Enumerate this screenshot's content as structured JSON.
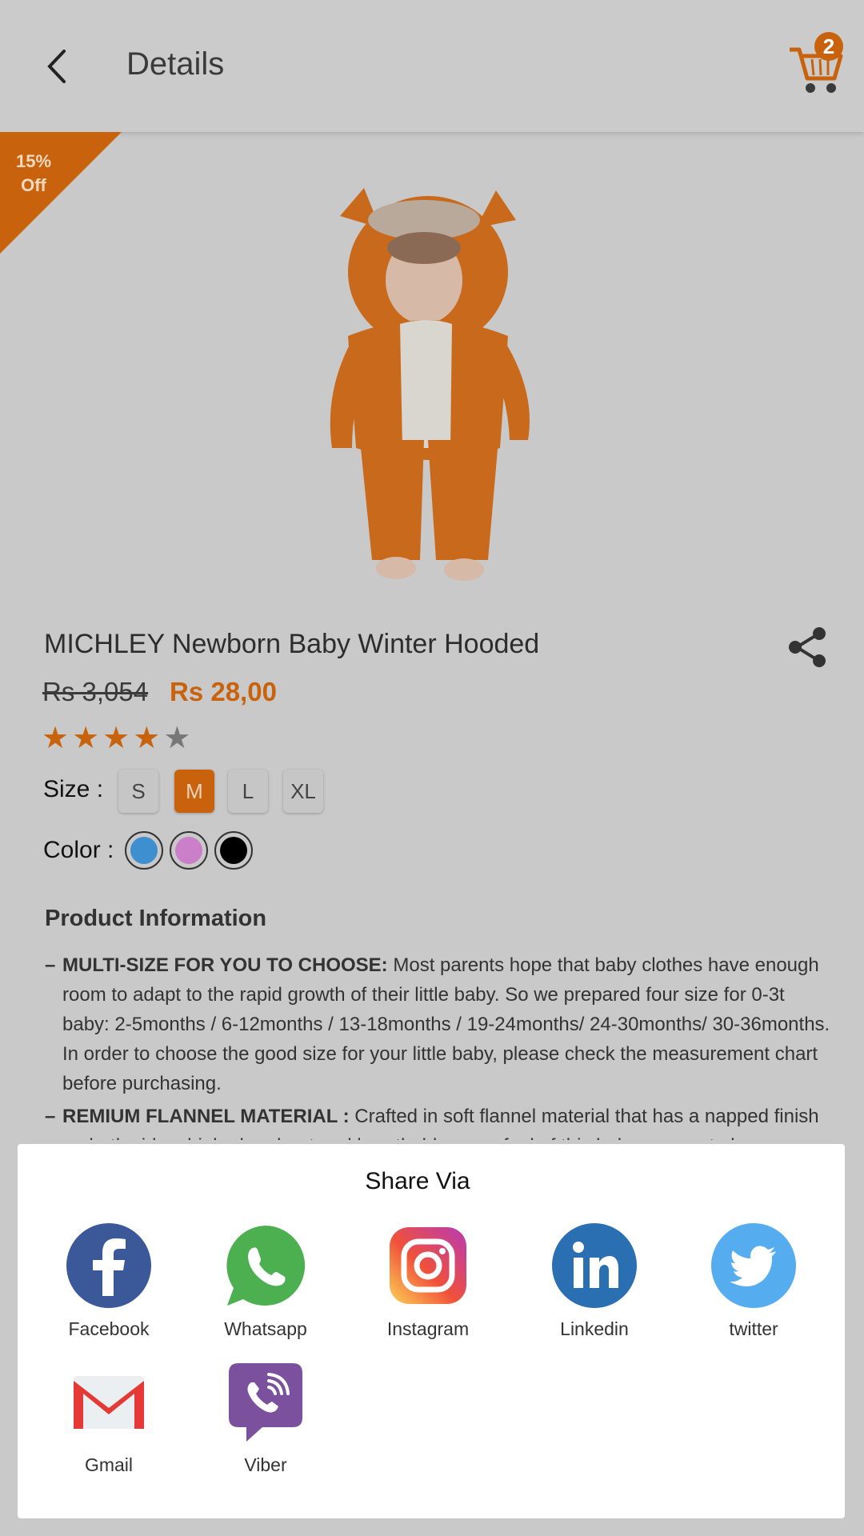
{
  "header": {
    "title": "Details",
    "cart_count": "2"
  },
  "discount": {
    "line1": "15%",
    "line2": "Off"
  },
  "product": {
    "name": "MICHLEY Newborn Baby Winter Hooded",
    "old_price": "Rs 3,054",
    "new_price": "Rs 28,00",
    "rating": 4,
    "rating_max": 5,
    "size_label": "Size :",
    "sizes": [
      "S",
      "M",
      "L",
      "XL"
    ],
    "selected_size": "M",
    "color_label": "Color :",
    "colors": [
      "#3d8fcf",
      "#cc7fc9",
      "#000000"
    ]
  },
  "info": {
    "title": "Product Information",
    "bullets": [
      {
        "head": "MULTI-SIZE FOR YOU TO CHOOSE:",
        "body": " Most parents hope that baby clothes have enough room to adapt to the rapid growth of their little baby. So we prepared four size for 0-3t baby: 2-5months / 6-12months / 13-18months / 19-24months/ 24-30months/ 30-36months. In order to choose the good size for your little baby, please check the measurement chart before purchasing."
      },
      {
        "head": "REMIUM FLANNEL MATERIAL :",
        "body": " Crafted in soft flannel material that has a napped finish on both sides, high absorbent and breathable, cozy feel of this baby romper to keep"
      }
    ]
  },
  "share": {
    "title": "Share Via",
    "items": [
      {
        "label": "Facebook",
        "icon": "facebook-icon"
      },
      {
        "label": "Whatsapp",
        "icon": "whatsapp-icon"
      },
      {
        "label": "Instagram",
        "icon": "instagram-icon"
      },
      {
        "label": "Linkedin",
        "icon": "linkedin-icon"
      },
      {
        "label": "twitter",
        "icon": "twitter-icon"
      },
      {
        "label": "Gmail",
        "icon": "gmail-icon"
      },
      {
        "label": "Viber",
        "icon": "viber-icon"
      }
    ]
  },
  "colors": {
    "accent": "#c8620c",
    "overlay": "#c9c9c9"
  }
}
